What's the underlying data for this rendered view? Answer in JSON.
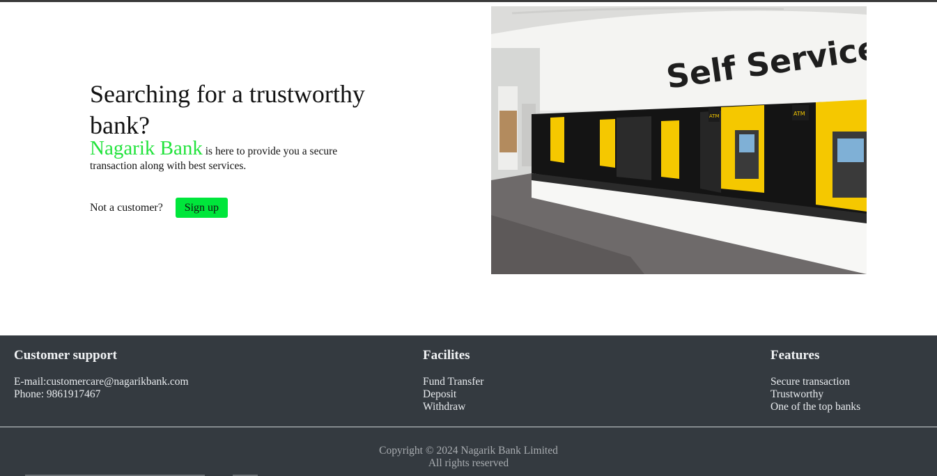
{
  "hero": {
    "headline": "Searching for a trustworthy bank?",
    "brand_name": "Nagarik Bank",
    "description": " is here to provide you a secure transaction along with best services.",
    "cta_label": "Not a customer?",
    "signup_button": "Sign up"
  },
  "photo": {
    "sign_text": "Self Service",
    "atm_label": "ATM"
  },
  "footer": {
    "support": {
      "title": "Customer support",
      "lines": [
        "E-mail:customercare@nagarikbank.com",
        "Phone: 9861917467"
      ]
    },
    "facilities": {
      "title": "Facilites",
      "items": [
        "Fund Transfer",
        "Deposit",
        "Withdraw"
      ]
    },
    "features": {
      "title": "Features",
      "items": [
        "Secure transaction",
        "Trustworthy",
        "One of the top banks"
      ]
    },
    "copyright_line1": "Copyright © 2024 Nagarik Bank Limited",
    "copyright_line2": "All rights reserved"
  },
  "colors": {
    "brand_green": "#22e33c",
    "button_green": "#00e63b",
    "footer_bg": "#343a40",
    "atm_yellow": "#f5c800"
  }
}
